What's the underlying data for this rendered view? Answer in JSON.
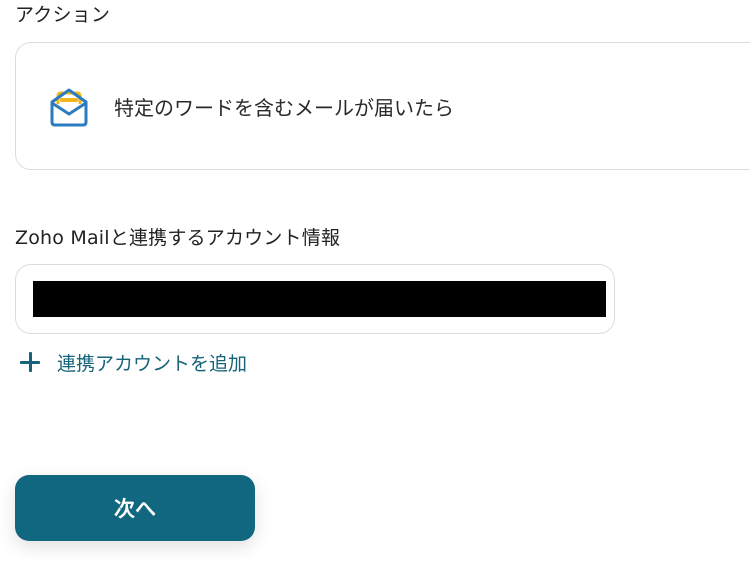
{
  "action_section": {
    "label": "アクション",
    "card_text": "特定のワードを含むメールが届いたら",
    "icon": "zoho-mail-icon"
  },
  "account_section": {
    "label": "Zoho Mailと連携するアカウント情報",
    "selected_account_redacted": true
  },
  "add_account": {
    "label": "連携アカウントを追加",
    "icon": "plus-icon"
  },
  "next_button": {
    "label": "次へ"
  },
  "colors": {
    "accent": "#10677f",
    "link": "#16637a",
    "border": "#d9dde2",
    "icon_blue": "#2a7bc0",
    "icon_yellow": "#f2b51c"
  }
}
